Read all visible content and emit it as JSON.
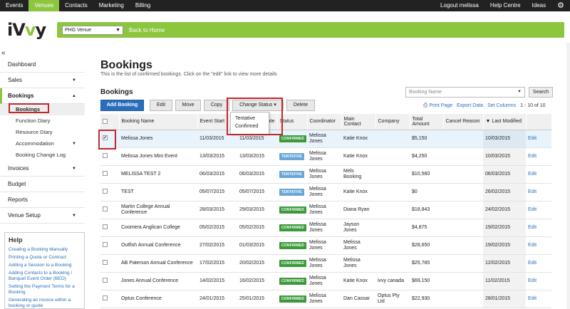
{
  "topnav": {
    "items": [
      {
        "label": "Events"
      },
      {
        "label": "Venues"
      },
      {
        "label": "Contacts"
      },
      {
        "label": "Marketing"
      },
      {
        "label": "Billing"
      }
    ],
    "right": {
      "logout": "Logout melissa",
      "help": "Help Centre",
      "ideas": "Ideas",
      "gear_icon": "gear-icon"
    }
  },
  "brand": {
    "logo_text": "iVvy",
    "accent": "#8cc63f"
  },
  "venuebar": {
    "selected_venue": "PHG Venue",
    "back_link": "Back to Home"
  },
  "sidebar": {
    "collapse_glyph": "«",
    "items": [
      {
        "label": "Dashboard"
      },
      {
        "label": "Sales"
      },
      {
        "label": "Bookings"
      },
      {
        "label": "Invoices"
      },
      {
        "label": "Budget"
      },
      {
        "label": "Reports"
      },
      {
        "label": "Venue Setup"
      }
    ],
    "sub_items": [
      {
        "label": "Bookings"
      },
      {
        "label": "Function Diary"
      },
      {
        "label": "Resource Diary"
      },
      {
        "label": "Accommodation"
      },
      {
        "label": "Booking Change Log"
      }
    ]
  },
  "help": {
    "title": "Help",
    "links": [
      "Creating a Booking Manually",
      "Printing a Quote or Contract",
      "Adding a Session to a Booking",
      "Adding Contacts to a Booking / Banquet Event Order (BEO)",
      "Setting the Payment Terms for a Booking",
      "Generating an invoice within a booking or quote"
    ]
  },
  "main": {
    "title": "Bookings",
    "description": "This is the list of confirmed bookings. Click on the \"edit\" link to view more details",
    "section_title": "Bookings",
    "search": {
      "placeholder": "Booking Name",
      "button": "Search"
    },
    "toolbar": {
      "add_booking": "Add Booking",
      "edit": "Edit",
      "move": "Move",
      "copy": "Copy",
      "change_status": "Change Status",
      "delete": "Delete"
    },
    "tool_links": {
      "print": "Print Page",
      "export": "Export Data",
      "columns": "Set Columns",
      "count": "1 - 10 of 10"
    },
    "status_menu": {
      "options": [
        "Tentative",
        "Confirmed"
      ]
    },
    "columns": [
      "Booking Name",
      "Event Start",
      "Date",
      "Status",
      "Coordinator",
      "Main Contact",
      "Company",
      "Total Amount",
      "Cancel Reason",
      "Last Modified"
    ],
    "rows": [
      {
        "selected": true,
        "name": "Melissa Jones",
        "start": "11/03/2015",
        "end": "11/03/2015",
        "status": "CONFIRMED",
        "coordinator": "Melissa Jones",
        "contact": "Katie Knox",
        "company": "",
        "total": "$5,150",
        "cancel": "",
        "modified": "10/03/2015",
        "action": "Edit"
      },
      {
        "selected": false,
        "name": "Melissa Jones Mini Event",
        "start": "13/03/2015",
        "end": "13/03/2015",
        "status": "TENTATIVE",
        "coordinator": "Melissa Jones",
        "contact": "Katie Knox",
        "company": "",
        "total": "$4,250",
        "cancel": "",
        "modified": "10/03/2015",
        "action": "Edit"
      },
      {
        "selected": false,
        "name": "MELISSA TEST 2",
        "start": "06/03/2015",
        "end": "06/03/2015",
        "status": "TENTATIVE",
        "coordinator": "Melissa Jones",
        "contact": "Mels Booking",
        "company": "",
        "total": "$10,560",
        "cancel": "",
        "modified": "06/03/2015",
        "action": "Edit"
      },
      {
        "selected": false,
        "name": "TEST",
        "start": "05/07/2015",
        "end": "05/07/2015",
        "status": "TENTATIVE",
        "coordinator": "Melissa Jones",
        "contact": "Katie Knox",
        "company": "",
        "total": "$0",
        "cancel": "",
        "modified": "26/02/2015",
        "action": "Edit"
      },
      {
        "selected": false,
        "name": "Martin College Annual Conference",
        "start": "28/03/2015",
        "end": "29/03/2015",
        "status": "CONFIRMED",
        "coordinator": "Melissa Jones",
        "contact": "Diana Ryan",
        "company": "",
        "total": "$18,843",
        "cancel": "",
        "modified": "24/02/2015",
        "action": "Edit"
      },
      {
        "selected": false,
        "name": "Coomera Anglican College",
        "start": "05/02/2015",
        "end": "05/02/2015",
        "status": "CONFIRMED",
        "coordinator": "Melissa Jones",
        "contact": "Jayson Jones",
        "company": "",
        "total": "$4,875",
        "cancel": "",
        "modified": "19/02/2015",
        "action": "Edit"
      },
      {
        "selected": false,
        "name": "Outfish Annual Conference",
        "start": "27/02/2015",
        "end": "01/03/2015",
        "status": "CONFIRMED",
        "coordinator": "Melissa Jones",
        "contact": "Melissa Jones",
        "company": "",
        "total": "$28,650",
        "cancel": "",
        "modified": "19/02/2015",
        "action": "Edit"
      },
      {
        "selected": false,
        "name": "AB Paterson Annual Conference",
        "start": "17/02/2015",
        "end": "20/02/2015",
        "status": "CONFIRMED",
        "coordinator": "Melissa Jones",
        "contact": "Melissa Jones",
        "company": "",
        "total": "$25,785",
        "cancel": "",
        "modified": "12/02/2015",
        "action": "Edit"
      },
      {
        "selected": false,
        "name": "Jones Annual Conference",
        "start": "14/02/2015",
        "end": "16/02/2015",
        "status": "CONFIRMED",
        "coordinator": "Melissa Jones",
        "contact": "Katie Knox",
        "company": "ivvy canada",
        "total": "$69,150",
        "cancel": "",
        "modified": "11/02/2015",
        "action": "Edit"
      },
      {
        "selected": false,
        "name": "Optus Conference",
        "start": "24/01/2015",
        "end": "25/01/2015",
        "status": "CONFIRMED",
        "coordinator": "Melissa Jones",
        "contact": "Dan Cassar",
        "company": "Optus Pty Ltd",
        "total": "$22,930",
        "cancel": "",
        "modified": "28/01/2015",
        "action": "Edit"
      }
    ]
  }
}
